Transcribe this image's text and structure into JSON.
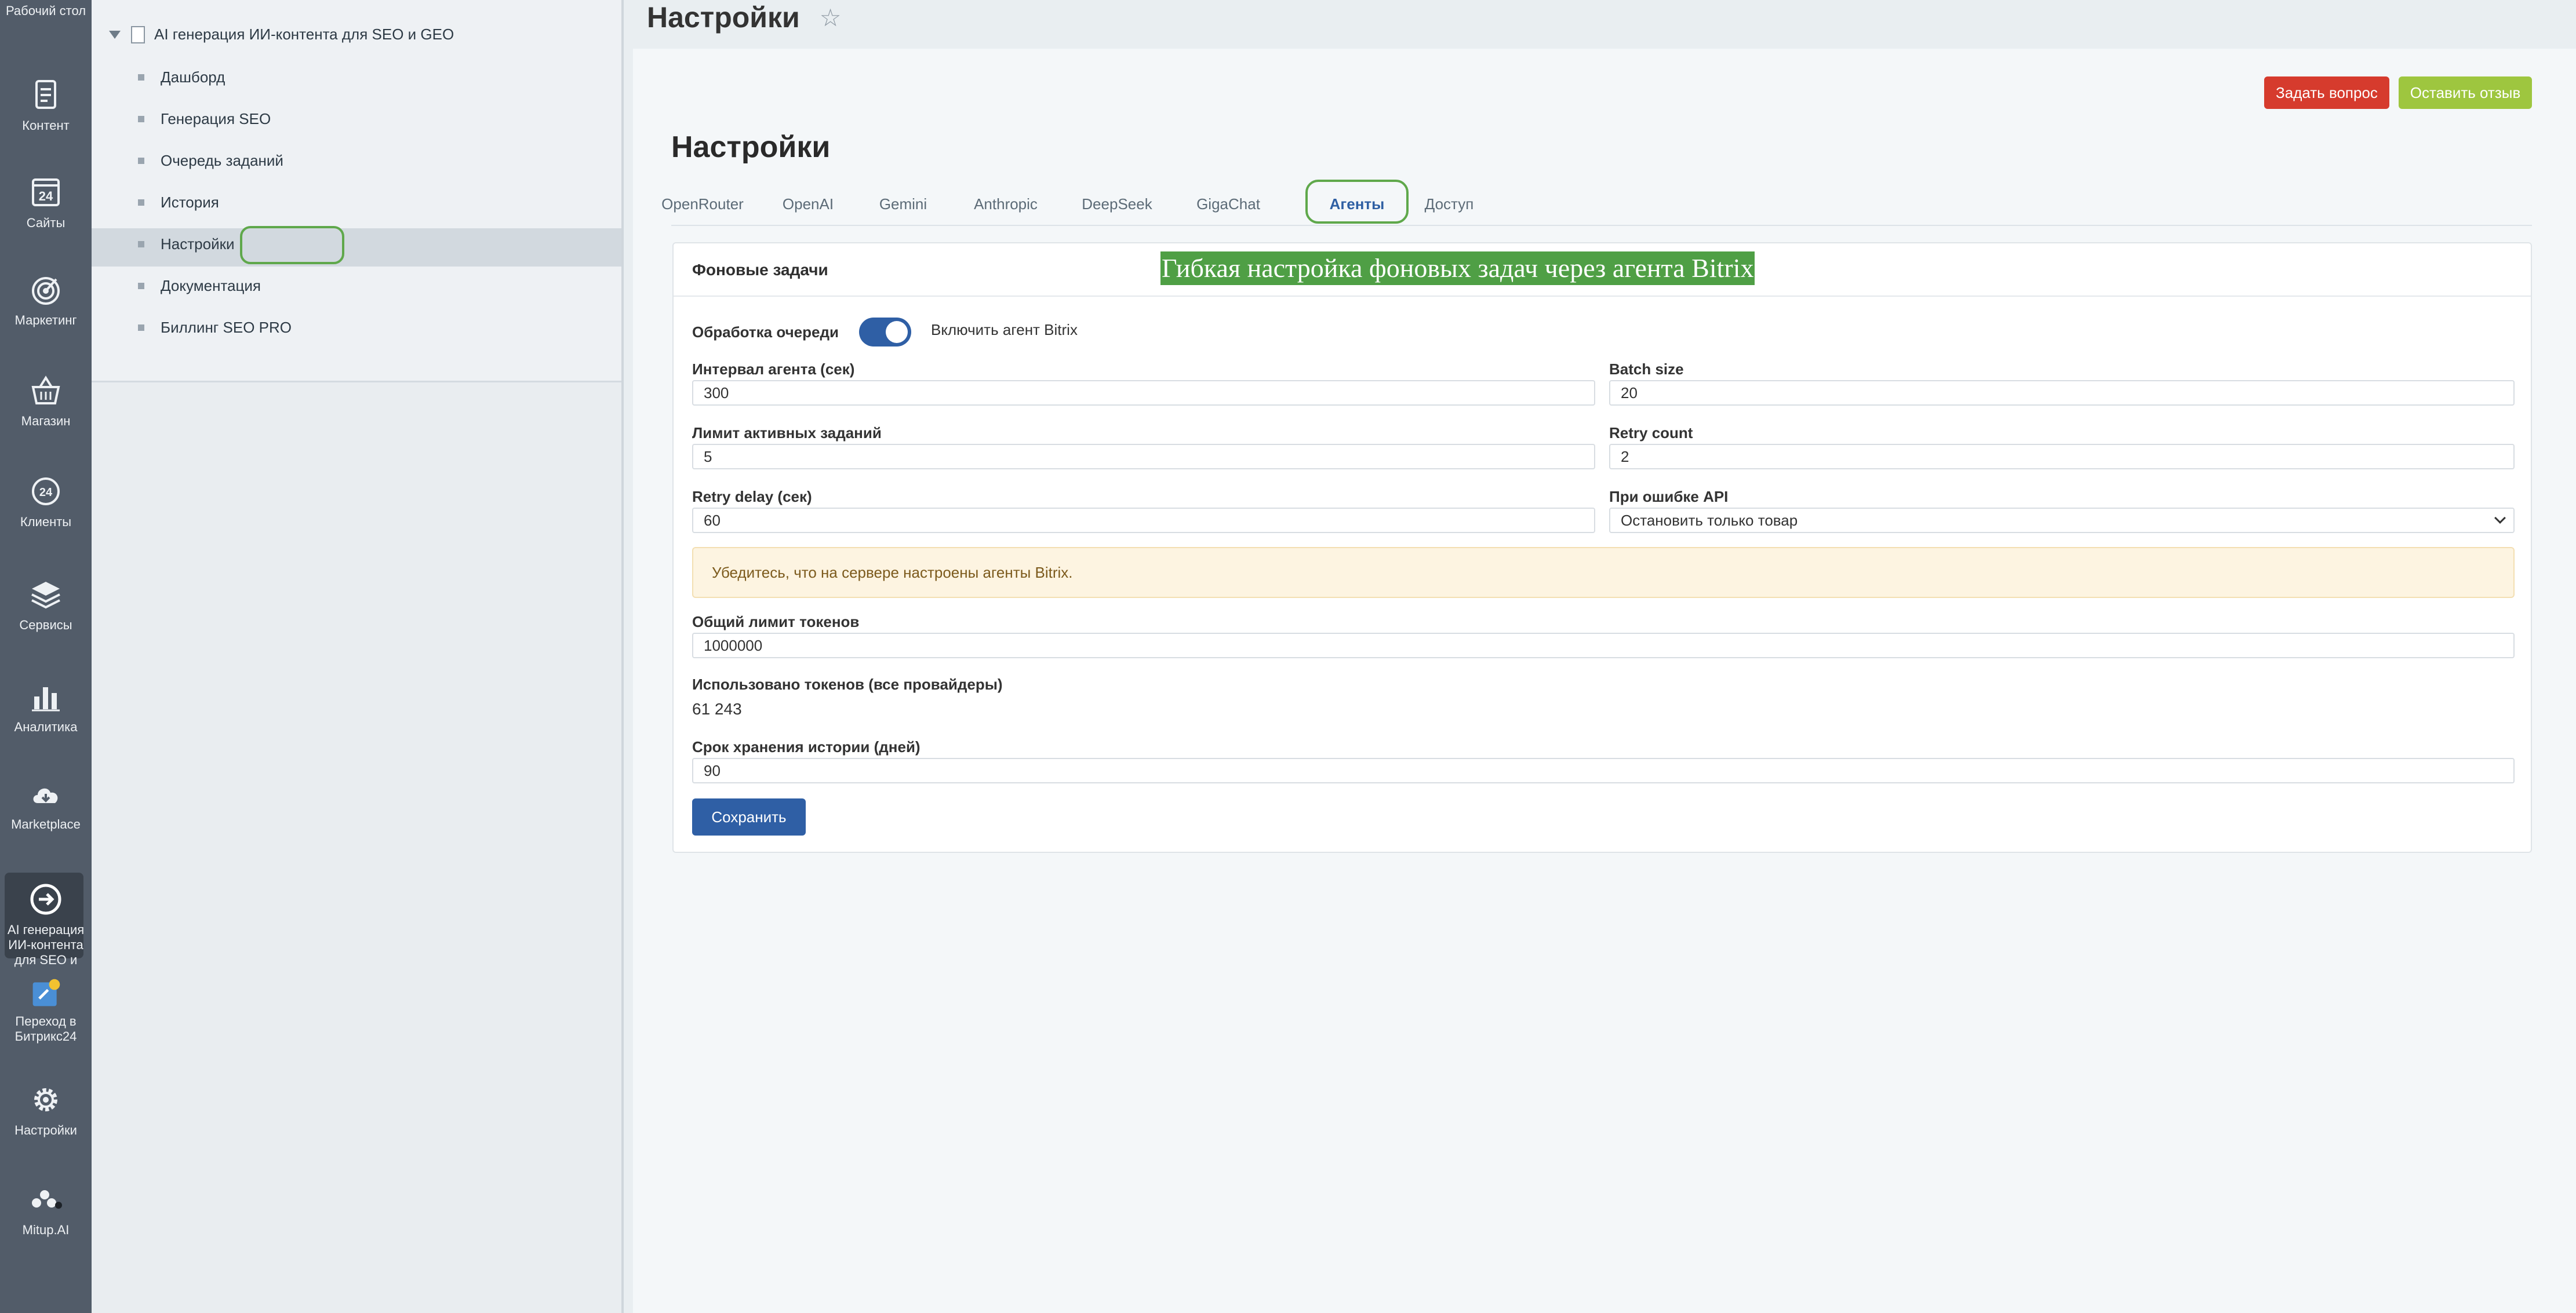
{
  "rail": {
    "items": [
      {
        "label": "Рабочий стол",
        "icon": "desktop-icon"
      },
      {
        "label": "Контент",
        "icon": "document-icon"
      },
      {
        "label": "Сайты",
        "icon": "calendar-24-icon"
      },
      {
        "label": "Маркетинг",
        "icon": "target-icon"
      },
      {
        "label": "Магазин",
        "icon": "basket-icon"
      },
      {
        "label": "Клиенты",
        "icon": "clients-24-icon"
      },
      {
        "label": "Сервисы",
        "icon": "layers-icon"
      },
      {
        "label": "Аналитика",
        "icon": "bar-chart-icon"
      },
      {
        "label": "Marketplace",
        "icon": "cloud-icon"
      },
      {
        "label": "AI генерация ИИ-контента для SEO и",
        "icon": "arrow-circle-icon"
      },
      {
        "label": "Переход в Битрикс24",
        "icon": "bitrix-icon"
      },
      {
        "label": "Настройки",
        "icon": "gear-icon"
      },
      {
        "label": "Mitup.AI",
        "icon": "mitup-logo-icon"
      }
    ]
  },
  "tree": {
    "root": "AI генерация ИИ-контента для SEO и GEO",
    "items": [
      "Дашборд",
      "Генерация SEO",
      "Очередь заданий",
      "История",
      "Настройки",
      "Документация",
      "Биллинг SEO PRO"
    ]
  },
  "header": {
    "title": "Настройки"
  },
  "actions": {
    "ask": "Задать вопрос",
    "review": "Оставить отзыв"
  },
  "settings": {
    "heading": "Настройки",
    "tabs": [
      "OpenRouter",
      "OpenAI",
      "Gemini",
      "Anthropic",
      "DeepSeek",
      "GigaChat",
      "Агенты",
      "Доступ"
    ],
    "active_tab": "Агенты"
  },
  "card": {
    "title": "Фоновые задачи",
    "promo": "Гибкая настройка фоновых задач через агента Bitrix",
    "queue": {
      "label": "Обработка очереди",
      "toggle_label": "Включить агент Bitrix",
      "enabled": true
    },
    "interval": {
      "label": "Интервал агента (сек)",
      "value": "300"
    },
    "batch": {
      "label": "Batch size",
      "value": "20"
    },
    "active_limit": {
      "label": "Лимит активных заданий",
      "value": "5"
    },
    "retry_count": {
      "label": "Retry count",
      "value": "2"
    },
    "retry_delay": {
      "label": "Retry delay (сек)",
      "value": "60"
    },
    "on_error": {
      "label": "При ошибке API",
      "value": "Остановить только товар"
    },
    "alert": "Убедитесь, что на сервере настроены агенты Bitrix.",
    "token_limit": {
      "label": "Общий лимит токенов",
      "value": "1000000"
    },
    "tokens_used": {
      "label": "Использовано токенов (все провайдеры)",
      "value": "61 243"
    },
    "history_days": {
      "label": "Срок хранения истории (дней)",
      "value": "90"
    },
    "save": "Сохранить"
  },
  "colors": {
    "rail": "#525c69",
    "primary": "#2f5fa5",
    "danger": "#d63b2d",
    "success": "#9ec63f",
    "highlight": "#5fa84b"
  }
}
